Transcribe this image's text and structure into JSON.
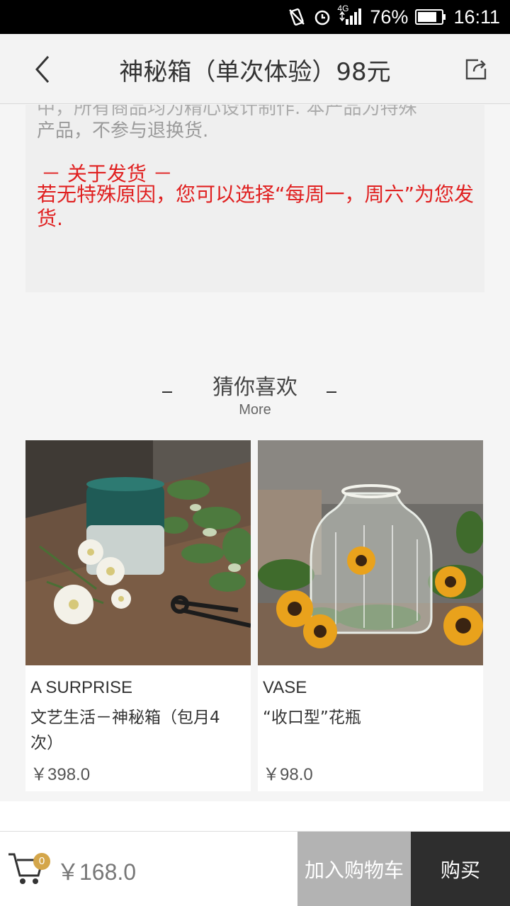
{
  "status_bar": {
    "network": "4G",
    "battery": "76%",
    "time": "16:11"
  },
  "header": {
    "title": "神秘箱（单次体验）98元"
  },
  "notice": {
    "cut_line": "中，所有商品均为精心设计制作. 本产品为特殊",
    "line2": "产品，不参与退换货.",
    "shipping_title": "－ 关于发货 －",
    "shipping_body": "若无特殊原因，您可以选择“每周一，周六”为您发货."
  },
  "recommend": {
    "title": "猜你喜欢",
    "more": "More"
  },
  "products": [
    {
      "en": "A SURPRISE",
      "cn": "文艺生活－神秘箱（包月4次）",
      "price": "￥398.0"
    },
    {
      "en": "VASE",
      "cn": "“收口型”花瓶",
      "price": "￥98.0"
    }
  ],
  "bottom_bar": {
    "cart_count": "0",
    "total": "￥168.0",
    "add_to_cart": "加入购物车",
    "buy": "购买"
  },
  "colors": {
    "accent_red": "#e02020",
    "badge_gold": "#d4a64a",
    "buy_dark": "#2e2e2e",
    "add_gray": "#b3b3b3"
  },
  "icons": [
    "vibrate-icon",
    "alarm-icon",
    "signal-icon",
    "battery-icon",
    "back-icon",
    "share-icon",
    "cart-icon"
  ]
}
